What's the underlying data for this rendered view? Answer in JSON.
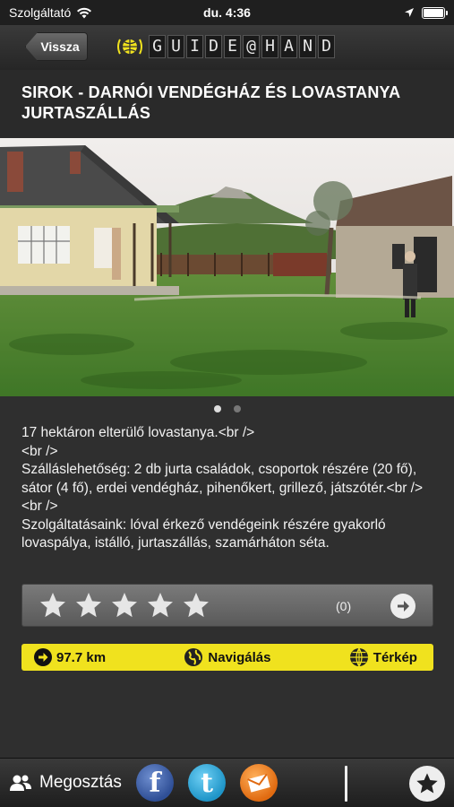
{
  "status_bar": {
    "carrier": "Szolgáltató",
    "time": "du. 4:36"
  },
  "nav": {
    "back_label": "Vissza",
    "brand_letters": [
      "G",
      "U",
      "I",
      "D",
      "E",
      "@",
      "H",
      "A",
      "N",
      "D"
    ]
  },
  "page": {
    "title": "SIROK - DARNÓI VENDÉGHÁZ ÉS LOVASTANYA JURTASZÁLLÁS"
  },
  "gallery": {
    "current_index": 1,
    "total": 2
  },
  "description": "17 hektáron elterülő lovastanya.<br />\n<br />\nSzálláslehetőség: 2 db jurta családok, csoportok részére (20 fő), sátor (4 fő), erdei vendégház, pihenőkert, grillező, játszótér.<br />\n<br />\nSzolgáltatásaink: lóval érkező vendégeink részére gyakorló lovaspálya, istálló, jurtaszállás, szamárháton séta.",
  "rating": {
    "stars": 0,
    "max_stars": 5,
    "count": "(0)"
  },
  "actions": {
    "distance": "97.7 km",
    "navigation": "Navigálás",
    "map": "Térkép"
  },
  "bottom": {
    "share_label": "Megosztás"
  },
  "colors": {
    "accent_yellow": "#f0e21e",
    "background": "#2f2f2f"
  }
}
